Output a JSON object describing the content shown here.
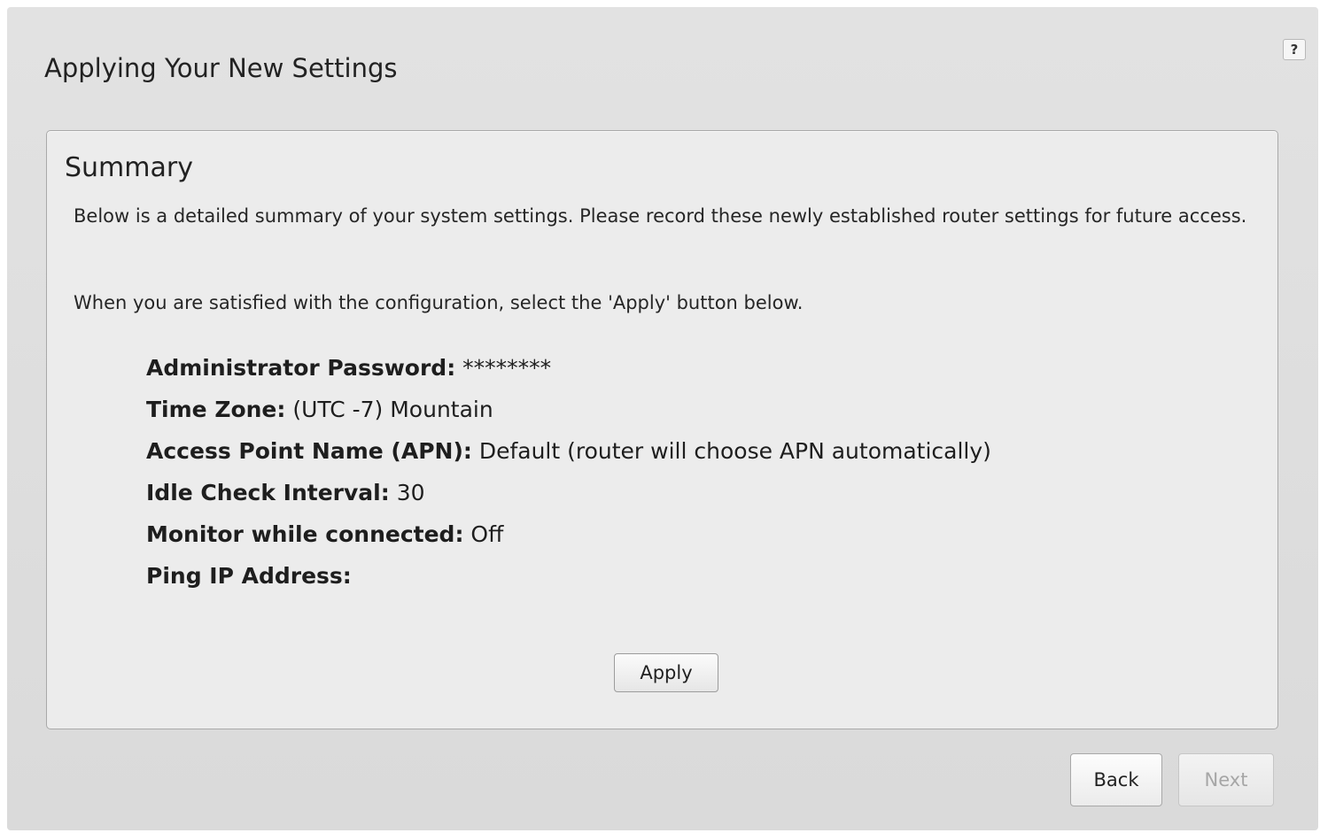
{
  "header": {
    "title": "Applying Your New Settings",
    "help_label": "?"
  },
  "summary": {
    "title": "Summary",
    "description": "Below is a detailed summary of your system settings. Please record these newly established router settings for future access.",
    "instruction": "When you are satisfied with the configuration, select the 'Apply' button below.",
    "settings": [
      {
        "label": "Administrator Password:",
        "value": "********"
      },
      {
        "label": "Time Zone:",
        "value": "(UTC -7) Mountain"
      },
      {
        "label": "Access Point Name (APN):",
        "value": "Default (router will choose APN automatically)"
      },
      {
        "label": "Idle Check Interval:",
        "value": "30"
      },
      {
        "label": "Monitor while connected:",
        "value": "Off"
      },
      {
        "label": "Ping IP Address:",
        "value": ""
      }
    ],
    "apply_label": "Apply"
  },
  "footer": {
    "back_label": "Back",
    "next_label": "Next",
    "next_enabled": false
  },
  "icons": {
    "help": "question-mark-icon"
  }
}
